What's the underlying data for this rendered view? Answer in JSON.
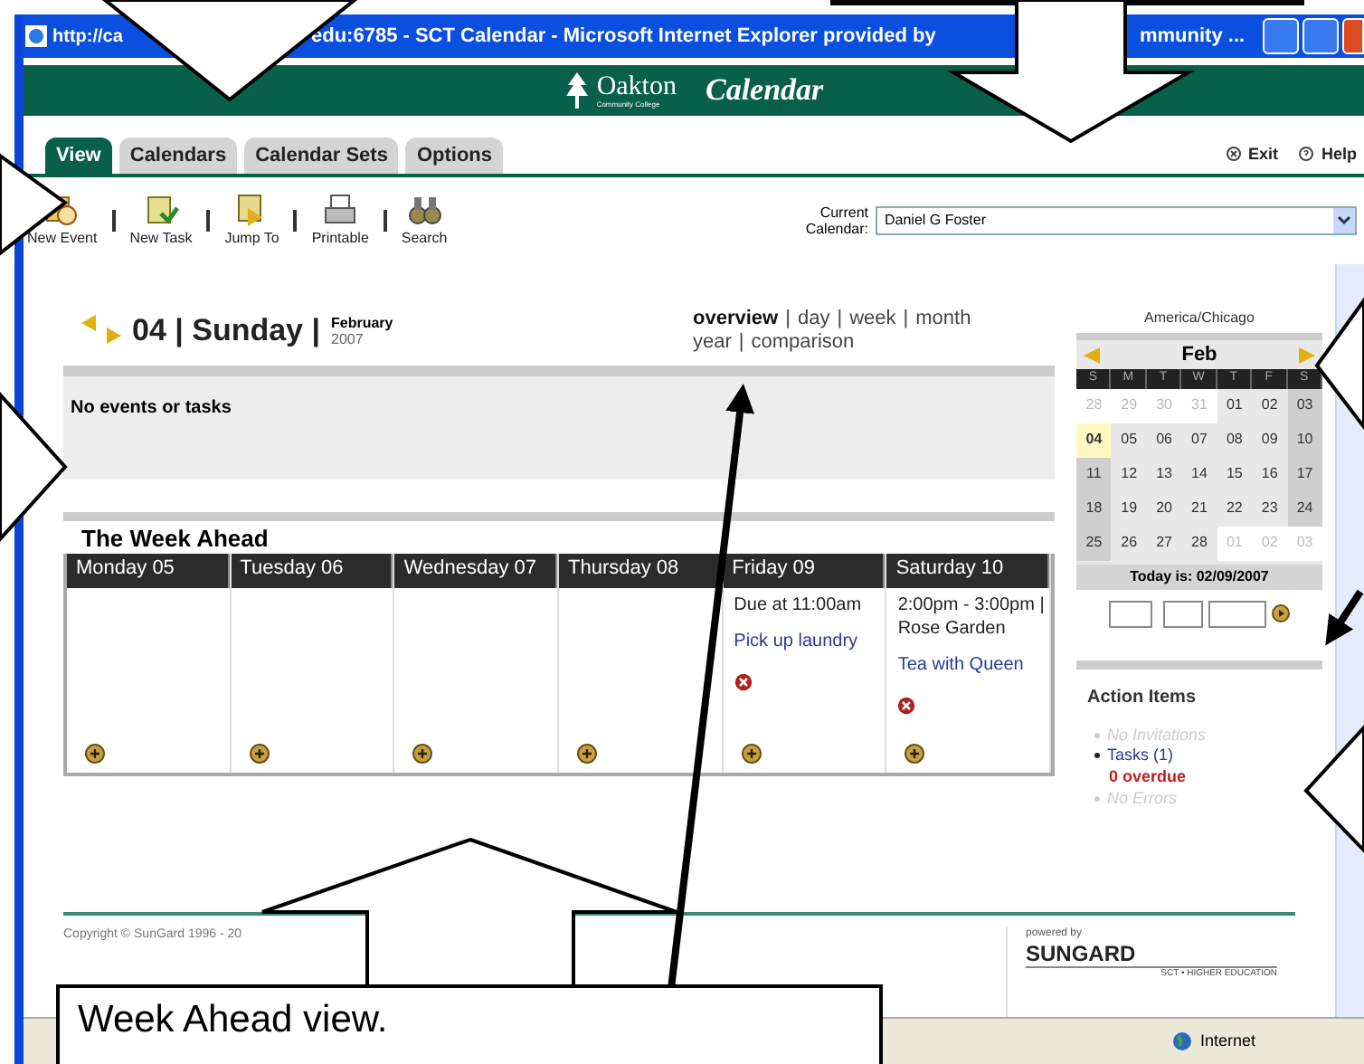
{
  "window": {
    "title_parts": [
      "http://ca",
      "edu:6785 - SCT Calendar - Microsoft Internet Explorer provided by",
      "mmunity ..."
    ]
  },
  "banner": {
    "logo": "Oakton",
    "logo_sub": "Community College",
    "title": "Calendar"
  },
  "tabs": [
    {
      "label": "View",
      "selected": true
    },
    {
      "label": "Calendars",
      "selected": false
    },
    {
      "label": "Calendar Sets",
      "selected": false
    },
    {
      "label": "Options",
      "selected": false
    }
  ],
  "header_links": [
    {
      "kind": "exit",
      "label": "Exit"
    },
    {
      "kind": "help",
      "label": "Help"
    }
  ],
  "toolbar": [
    {
      "kind": "event",
      "label": "New Event"
    },
    {
      "kind": "task",
      "label": "New Task"
    },
    {
      "kind": "jump",
      "label": "Jump To"
    },
    {
      "kind": "print",
      "label": "Printable"
    },
    {
      "kind": "search",
      "label": "Search"
    }
  ],
  "current_calendar": {
    "label": "Current Calendar:",
    "value": "Daniel G Foster"
  },
  "date_header": {
    "day": "04 | Sunday |",
    "month": "February",
    "year": "2007"
  },
  "view_separator": "|",
  "views": [
    {
      "label": "overview",
      "selected": true
    },
    {
      "label": "day",
      "selected": false
    },
    {
      "label": "week",
      "selected": false
    },
    {
      "label": "month",
      "selected": false
    },
    {
      "label": "year",
      "selected": false
    },
    {
      "label": "comparison",
      "selected": false
    }
  ],
  "day_events": {
    "message": "No events or tasks"
  },
  "week_ahead": {
    "title": "The Week Ahead",
    "days": [
      {
        "header": "Monday 05"
      },
      {
        "header": "Tuesday 06"
      },
      {
        "header": "Wednesday 07"
      },
      {
        "header": "Thursday 08"
      },
      {
        "header": "Friday 09",
        "entries": [
          {
            "kind": "text",
            "text": "Due at 11:00am"
          },
          {
            "kind": "link",
            "text": "Pick up laundry"
          },
          {
            "kind": "delete"
          }
        ]
      },
      {
        "header": "Saturday 10",
        "entries": [
          {
            "kind": "text",
            "text": "2:00pm - 3:00pm | Rose Garden"
          },
          {
            "kind": "link",
            "text": "Tea with Queen"
          },
          {
            "kind": "delete"
          }
        ]
      }
    ]
  },
  "mini_calendar": {
    "timezone": "America/Chicago",
    "month": "Feb",
    "weekdays": [
      "S",
      "M",
      "T",
      "W",
      "T",
      "F",
      "S"
    ],
    "weeks": [
      [
        {
          "label": "28",
          "in_month": false,
          "selected": false
        },
        {
          "label": "29",
          "in_month": false,
          "selected": false
        },
        {
          "label": "30",
          "in_month": false,
          "selected": false
        },
        {
          "label": "31",
          "in_month": false,
          "selected": false
        },
        {
          "label": "01",
          "in_month": true,
          "selected": false
        },
        {
          "label": "02",
          "in_month": true,
          "selected": false
        },
        {
          "label": "03",
          "in_month": true,
          "selected": false
        }
      ],
      [
        {
          "label": "04",
          "in_month": true,
          "selected": true
        },
        {
          "label": "05",
          "in_month": true,
          "selected": false
        },
        {
          "label": "06",
          "in_month": true,
          "selected": false
        },
        {
          "label": "07",
          "in_month": true,
          "selected": false
        },
        {
          "label": "08",
          "in_month": true,
          "selected": false
        },
        {
          "label": "09",
          "in_month": true,
          "selected": false
        },
        {
          "label": "10",
          "in_month": true,
          "selected": false
        }
      ],
      [
        {
          "label": "11",
          "in_month": true,
          "selected": false
        },
        {
          "label": "12",
          "in_month": true,
          "selected": false
        },
        {
          "label": "13",
          "in_month": true,
          "selected": false
        },
        {
          "label": "14",
          "in_month": true,
          "selected": false
        },
        {
          "label": "15",
          "in_month": true,
          "selected": false
        },
        {
          "label": "16",
          "in_month": true,
          "selected": false
        },
        {
          "label": "17",
          "in_month": true,
          "selected": false
        }
      ],
      [
        {
          "label": "18",
          "in_month": true,
          "selected": false
        },
        {
          "label": "19",
          "in_month": true,
          "selected": false
        },
        {
          "label": "20",
          "in_month": true,
          "selected": false
        },
        {
          "label": "21",
          "in_month": true,
          "selected": false
        },
        {
          "label": "22",
          "in_month": true,
          "selected": false
        },
        {
          "label": "23",
          "in_month": true,
          "selected": false
        },
        {
          "label": "24",
          "in_month": true,
          "selected": false
        }
      ],
      [
        {
          "label": "25",
          "in_month": true,
          "selected": false
        },
        {
          "label": "26",
          "in_month": true,
          "selected": false
        },
        {
          "label": "27",
          "in_month": true,
          "selected": false
        },
        {
          "label": "28",
          "in_month": true,
          "selected": false
        },
        {
          "label": "01",
          "in_month": false,
          "selected": false
        },
        {
          "label": "02",
          "in_month": false,
          "selected": false
        },
        {
          "label": "03",
          "in_month": false,
          "selected": false
        }
      ]
    ],
    "today": "Today is: 02/09/2007"
  },
  "action_items": {
    "title": "Action Items",
    "items": [
      {
        "label": "No Invitations",
        "disabled": true
      },
      {
        "label": "Tasks (1)",
        "disabled": false,
        "note": "0 overdue"
      },
      {
        "label": "No Errors",
        "disabled": true
      }
    ]
  },
  "footer": {
    "copyright": "Copyright © SunGard 1996 - 20",
    "powered_by": "powered by",
    "brand": "SUNGARD",
    "brand_sub": "SCT • HIGHER EDUCATION"
  },
  "status_bar": {
    "zone": "Internet"
  },
  "callout": {
    "text": "Week Ahead view."
  }
}
